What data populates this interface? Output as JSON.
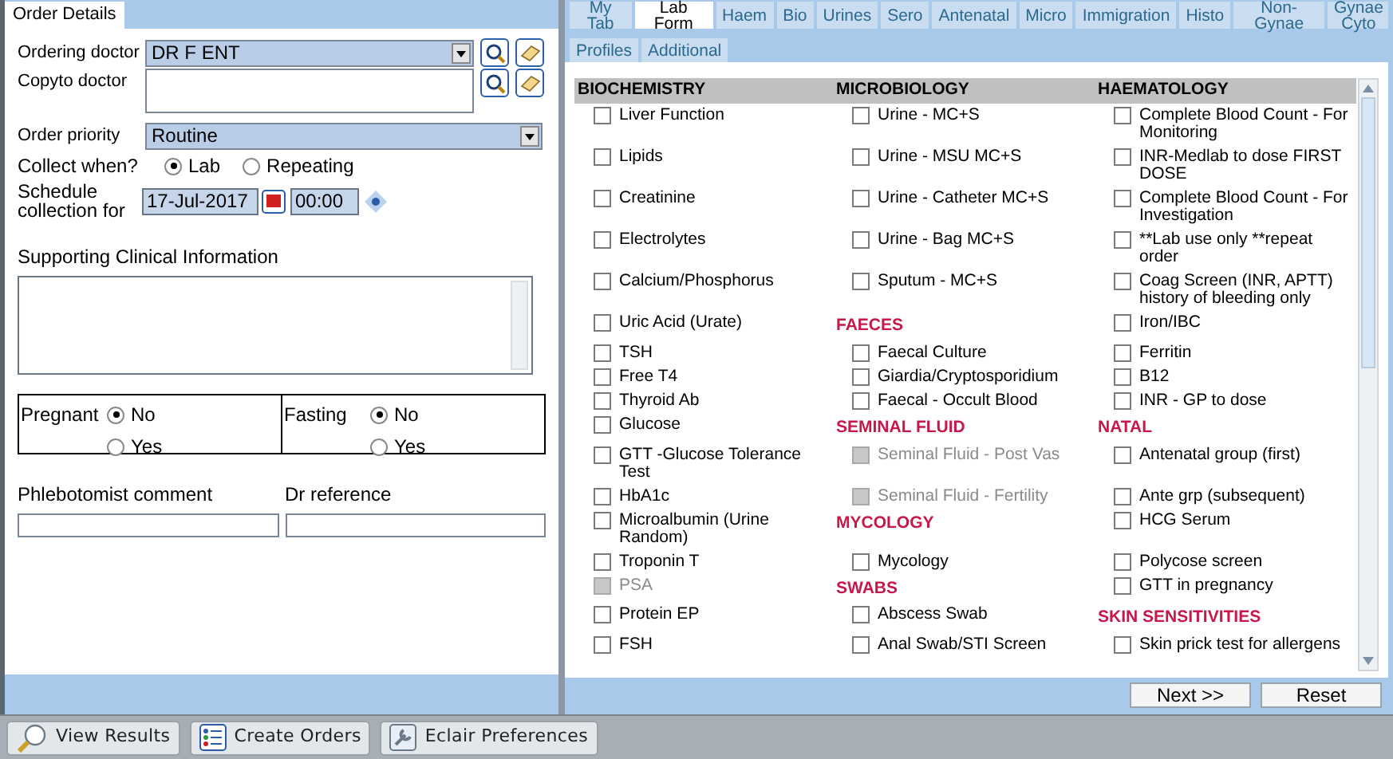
{
  "order_details": {
    "tab": {
      "label": "Order Details",
      "selected": true
    },
    "ordering_doctor": {
      "label": "Ordering doctor",
      "value": "DR F ENT"
    },
    "copyto_doctor": {
      "label": "Copyto doctor"
    },
    "order_priority": {
      "label": "Order priority",
      "value": "Routine"
    },
    "collect_when": {
      "label": "Collect when?",
      "options": [
        {
          "label": "Lab",
          "selected": true
        },
        {
          "label": "Repeating",
          "selected": false
        }
      ]
    },
    "schedule": {
      "label": "Schedule collection for",
      "date": "17-Jul-2017",
      "time": "00:00"
    },
    "clinical_info": {
      "label": "Supporting Clinical Information"
    },
    "flags": [
      {
        "label": "Pregnant",
        "options": [
          {
            "label": "No",
            "selected": true
          },
          {
            "label": "Yes",
            "selected": false
          }
        ]
      },
      {
        "label": "Fasting",
        "options": [
          {
            "label": "No",
            "selected": true
          },
          {
            "label": "Yes",
            "selected": false
          }
        ]
      }
    ],
    "phlebotomist_comment": {
      "label": "Phlebotomist comment"
    },
    "dr_reference": {
      "label": "Dr reference"
    }
  },
  "tab_rows": [
    [
      {
        "label": "My Tab",
        "selected": false
      },
      {
        "label": "Lab Form",
        "selected": true
      },
      {
        "label": "Haem",
        "selected": false
      },
      {
        "label": "Bio",
        "selected": false
      },
      {
        "label": "Urines",
        "selected": false
      },
      {
        "label": "Sero",
        "selected": false
      },
      {
        "label": "Antenatal",
        "selected": false
      },
      {
        "label": "Micro",
        "selected": false
      },
      {
        "label": "Immigration",
        "selected": false
      },
      {
        "label": "Histo",
        "selected": false
      },
      {
        "label": "Non-Gynae",
        "selected": false
      },
      {
        "label": "Gynae Cyto",
        "selected": false
      }
    ],
    [
      {
        "label": "Profiles",
        "selected": false
      },
      {
        "label": "Additional",
        "selected": false
      }
    ]
  ],
  "lab_form": {
    "columns": [
      "BIOCHEMISTRY",
      "MICROBIOLOGY",
      "HAEMATOLOGY"
    ],
    "rows": [
      [
        {
          "kind": "item",
          "label": "Liver Function",
          "checked": false,
          "disabled": false
        },
        {
          "kind": "item",
          "label": "Urine - MC+S",
          "checked": false,
          "disabled": false
        },
        {
          "kind": "item",
          "label": "Complete Blood Count - For Monitoring",
          "checked": false,
          "disabled": false
        }
      ],
      [
        {
          "kind": "item",
          "label": "Lipids",
          "checked": false,
          "disabled": false
        },
        {
          "kind": "item",
          "label": "Urine - MSU MC+S",
          "checked": false,
          "disabled": false
        },
        {
          "kind": "item",
          "label": "INR-Medlab to dose FIRST DOSE",
          "checked": false,
          "disabled": false
        }
      ],
      [
        {
          "kind": "item",
          "label": "Creatinine",
          "checked": false,
          "disabled": false
        },
        {
          "kind": "item",
          "label": "Urine - Catheter MC+S",
          "checked": false,
          "disabled": false
        },
        {
          "kind": "item",
          "label": "Complete Blood Count - For Investigation",
          "checked": false,
          "disabled": false
        }
      ],
      [
        {
          "kind": "item",
          "label": "Electrolytes",
          "checked": false,
          "disabled": false
        },
        {
          "kind": "item",
          "label": "Urine - Bag MC+S",
          "checked": false,
          "disabled": false
        },
        {
          "kind": "item",
          "label": "**Lab use only **repeat order",
          "checked": false,
          "disabled": false
        }
      ],
      [
        {
          "kind": "item",
          "label": "Calcium/Phosphorus",
          "checked": false,
          "disabled": false
        },
        {
          "kind": "item",
          "label": "Sputum - MC+S",
          "checked": false,
          "disabled": false
        },
        {
          "kind": "item",
          "label": "Coag Screen (INR, APTT) history of bleeding only",
          "checked": false,
          "disabled": false
        }
      ],
      [
        {
          "kind": "item",
          "label": "Uric Acid (Urate)",
          "checked": false,
          "disabled": false
        },
        {
          "kind": "header",
          "label": "FAECES"
        },
        {
          "kind": "item",
          "label": "Iron/IBC",
          "checked": false,
          "disabled": false
        }
      ],
      [
        {
          "kind": "item",
          "label": "TSH",
          "checked": false,
          "disabled": false
        },
        {
          "kind": "item",
          "label": "Faecal Culture",
          "checked": false,
          "disabled": false
        },
        {
          "kind": "item",
          "label": "Ferritin",
          "checked": false,
          "disabled": false
        }
      ],
      [
        {
          "kind": "item",
          "label": "Free T4",
          "checked": false,
          "disabled": false
        },
        {
          "kind": "item",
          "label": "Giardia/Cryptosporidium",
          "checked": false,
          "disabled": false
        },
        {
          "kind": "item",
          "label": "B12",
          "checked": false,
          "disabled": false
        }
      ],
      [
        {
          "kind": "item",
          "label": "Thyroid Ab",
          "checked": false,
          "disabled": false
        },
        {
          "kind": "item",
          "label": "Faecal - Occult Blood",
          "checked": false,
          "disabled": false
        },
        {
          "kind": "item",
          "label": "INR - GP to dose",
          "checked": false,
          "disabled": false
        }
      ],
      [
        {
          "kind": "item",
          "label": "Glucose",
          "checked": false,
          "disabled": false
        },
        {
          "kind": "header",
          "label": "SEMINAL FLUID"
        },
        {
          "kind": "header",
          "label": "NATAL"
        }
      ],
      [
        {
          "kind": "item",
          "label": "GTT -Glucose Tolerance Test",
          "checked": false,
          "disabled": false
        },
        {
          "kind": "item",
          "label": "Seminal Fluid - Post Vas",
          "checked": false,
          "disabled": true
        },
        {
          "kind": "item",
          "label": "Antenatal group (first)",
          "checked": false,
          "disabled": false
        }
      ],
      [
        {
          "kind": "item",
          "label": "HbA1c",
          "checked": false,
          "disabled": false
        },
        {
          "kind": "item",
          "label": "Seminal Fluid - Fertility",
          "checked": false,
          "disabled": true
        },
        {
          "kind": "item",
          "label": "Ante grp (subsequent)",
          "checked": false,
          "disabled": false
        }
      ],
      [
        {
          "kind": "item",
          "label": "Microalbumin (Urine Random)",
          "checked": false,
          "disabled": false
        },
        {
          "kind": "header",
          "label": "MYCOLOGY"
        },
        {
          "kind": "item",
          "label": "HCG Serum",
          "checked": false,
          "disabled": false
        }
      ],
      [
        {
          "kind": "item",
          "label": "Troponin T",
          "checked": false,
          "disabled": false
        },
        {
          "kind": "item",
          "label": "Mycology",
          "checked": false,
          "disabled": false
        },
        {
          "kind": "item",
          "label": "Polycose screen",
          "checked": false,
          "disabled": false
        }
      ],
      [
        {
          "kind": "item",
          "label": "PSA",
          "checked": false,
          "disabled": true
        },
        {
          "kind": "header",
          "label": "SWABS"
        },
        {
          "kind": "item",
          "label": "GTT in pregnancy",
          "checked": false,
          "disabled": false
        }
      ],
      [
        {
          "kind": "item",
          "label": "Protein EP",
          "checked": false,
          "disabled": false
        },
        {
          "kind": "item",
          "label": "Abscess Swab",
          "checked": false,
          "disabled": false
        },
        {
          "kind": "header",
          "label": "SKIN SENSITIVITIES"
        }
      ],
      [
        {
          "kind": "item",
          "label": "FSH",
          "checked": false,
          "disabled": false
        },
        {
          "kind": "item",
          "label": "Anal Swab/STI Screen",
          "checked": false,
          "disabled": false
        },
        {
          "kind": "item",
          "label": "Skin prick test for allergens",
          "checked": false,
          "disabled": false
        }
      ]
    ]
  },
  "form_buttons": [
    "Next >>",
    "Reset"
  ],
  "taskbar": [
    {
      "kind": "search",
      "label": "View Results"
    },
    {
      "kind": "list",
      "label": "Create Orders"
    },
    {
      "kind": "wrench",
      "label": "Eclair Preferences"
    }
  ]
}
